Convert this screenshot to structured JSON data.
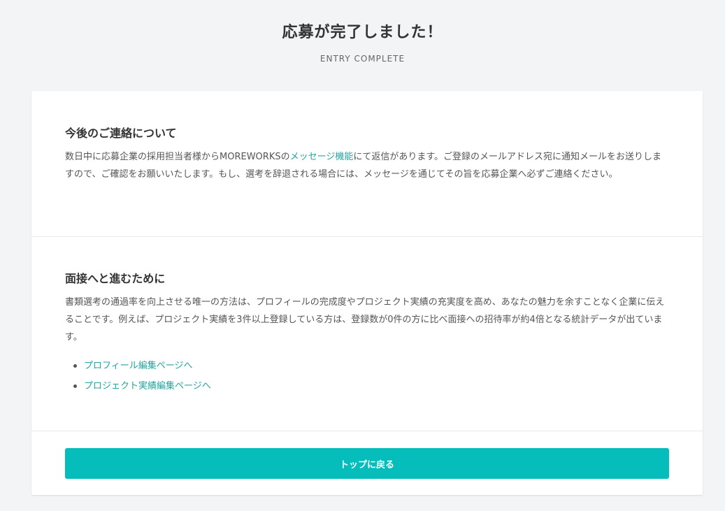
{
  "header": {
    "title": "応募が完了しました！",
    "subtitle": "ENTRY COMPLETE"
  },
  "contact_section": {
    "heading": "今後のご連絡について",
    "body_before_link": "数日中に応募企業の採用担当者様からMOREWORKSの",
    "link_label": "メッセージ機能",
    "body_after_link": "にて返信があります。ご登録のメールアドレス宛に通知メールをお送りしますので、ご確認をお願いいたします。もし、選考を辞退される場合には、メッセージを通じてその旨を応募企業へ必ずご連絡ください。"
  },
  "interview_section": {
    "heading": "面接へと進むために",
    "body": "書類選考の通過率を向上させる唯一の方法は、プロフィールの完成度やプロジェクト実績の充実度を高め、あなたの魅力を余すことなく企業に伝えることです。例えば、プロジェクト実績を3件以上登録している方は、登録数が0件の方に比べ面接への招待率が約4倍となる統計データが出ています。",
    "links": [
      {
        "label": "プロフィール編集ページへ"
      },
      {
        "label": "プロジェクト実績編集ページへ"
      }
    ]
  },
  "footer": {
    "button_label": "トップに戻る"
  },
  "colors": {
    "accent": "#05bdba",
    "link": "#21a5a0",
    "background": "#f2f4f5"
  }
}
